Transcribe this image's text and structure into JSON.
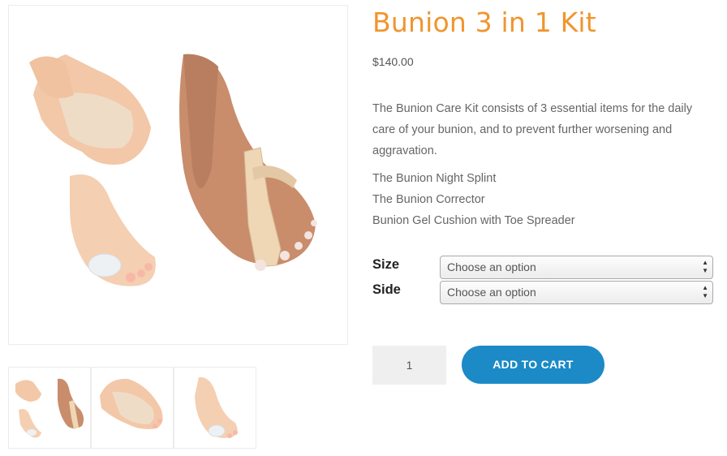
{
  "product": {
    "title": "Bunion 3 in 1 Kit",
    "price": "$140.00",
    "description": "The Bunion Care Kit consists of 3 essential items for the daily care of your bunion, and to prevent further worsening and aggravation.",
    "features": [
      "The Bunion Night Splint",
      "The Bunion Corrector",
      "Bunion Gel Cushion with Toe Spreader"
    ]
  },
  "options": {
    "size": {
      "label": "Size",
      "value": "Choose an option"
    },
    "side": {
      "label": "Side",
      "value": "Choose an option"
    }
  },
  "cart": {
    "quantity": "1",
    "add_label": "ADD TO CART"
  },
  "colors": {
    "title": "#f0952e",
    "button": "#1b8ac7"
  },
  "icons": {
    "select_arrows": "select-arrows-icon"
  }
}
